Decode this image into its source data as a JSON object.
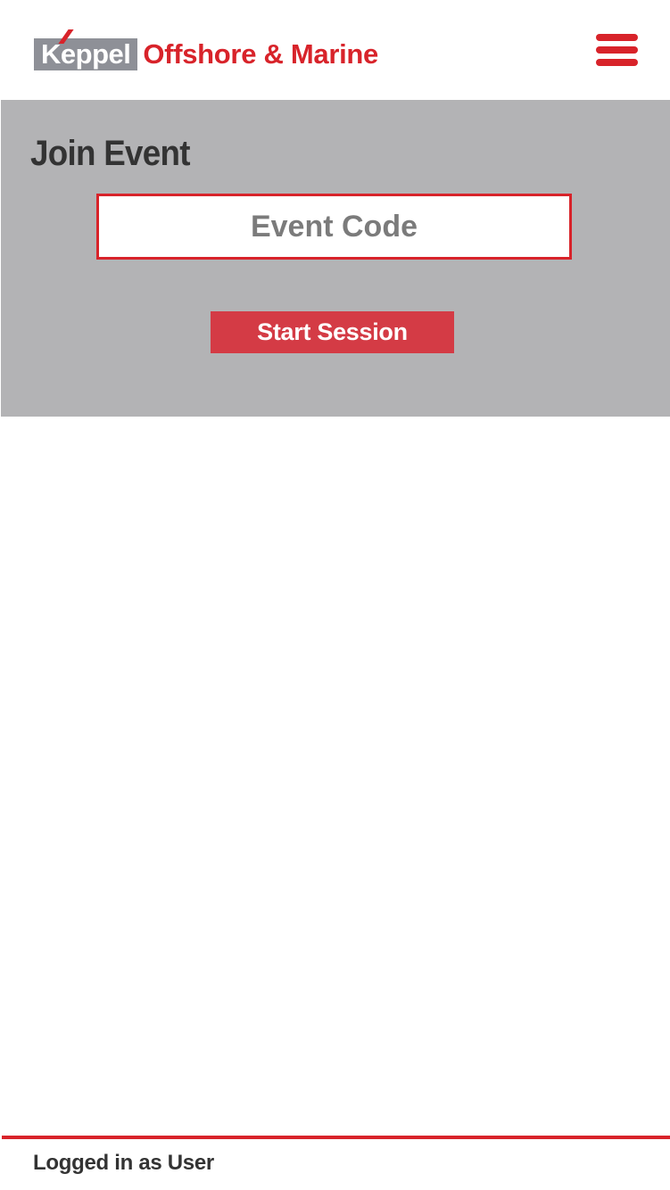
{
  "header": {
    "logo_brand": "Keppel",
    "logo_text": "Offshore & Marine",
    "menu_icon": "hamburger-menu-icon"
  },
  "join_event": {
    "title": "Join Event",
    "event_code_placeholder": "Event Code",
    "event_code_value": "",
    "start_button_label": "Start Session"
  },
  "footer": {
    "status_text": "Logged in as User"
  },
  "colors": {
    "brand_red": "#d8232a",
    "button_red": "#d43b45",
    "panel_gray": "#b3b3b5",
    "logo_gray": "#8e9097",
    "text_dark": "#333333"
  }
}
